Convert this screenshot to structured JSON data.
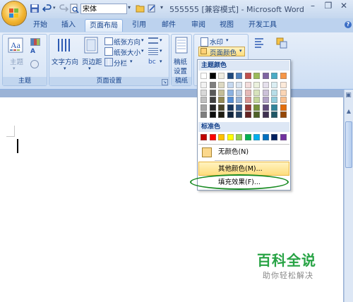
{
  "window": {
    "title": "555555 [兼容模式] - Microsoft Word"
  },
  "quick_access": {
    "font_name": "宋体"
  },
  "tabs": [
    {
      "label": "开始"
    },
    {
      "label": "插入"
    },
    {
      "label": "页面布局",
      "active": true
    },
    {
      "label": "引用"
    },
    {
      "label": "邮件"
    },
    {
      "label": "审阅"
    },
    {
      "label": "视图"
    },
    {
      "label": "开发工具"
    }
  ],
  "ribbon": {
    "theme_group": {
      "label": "主题",
      "theme_button": "主题"
    },
    "page_setup_group": {
      "label": "页面设置",
      "text_direction": "文字方向",
      "margins": "页边距",
      "orientation": "纸张方向",
      "size": "纸张大小",
      "columns": "分栏"
    },
    "manuscript_group": {
      "label": "稿纸",
      "setup_button_line1": "稿纸",
      "setup_button_line2": "设置"
    },
    "page_background_group": {
      "watermark": "水印",
      "page_color": "页面颜色"
    }
  },
  "page_color_menu": {
    "theme_colors_header": "主题颜色",
    "standard_colors_header": "标准色",
    "no_color": "无颜色(N)",
    "more_colors": "其他颜色(M)...",
    "fill_effects": "填充效果(F)...",
    "theme_columns": [
      [
        "#ffffff",
        "#f2f2f2",
        "#d8d8d8",
        "#bfbfbf",
        "#a5a5a5",
        "#7f7f7f"
      ],
      [
        "#000000",
        "#7f7f7f",
        "#595959",
        "#3f3f3f",
        "#262626",
        "#0c0c0c"
      ],
      [
        "#eeece1",
        "#ddd9c3",
        "#c4bd97",
        "#938953",
        "#494429",
        "#1d1b10"
      ],
      [
        "#1f497d",
        "#c6d9f0",
        "#8db3e2",
        "#548dd4",
        "#17365d",
        "#0f243e"
      ],
      [
        "#4f81bd",
        "#dbe5f1",
        "#b8cce4",
        "#95b3d7",
        "#366092",
        "#244061"
      ],
      [
        "#c0504d",
        "#f2dcdb",
        "#e5b9b7",
        "#d99694",
        "#953734",
        "#632423"
      ],
      [
        "#9bbb59",
        "#ebf1dd",
        "#d7e3bc",
        "#c3d69b",
        "#76923c",
        "#4f6128"
      ],
      [
        "#8064a2",
        "#e5e0ec",
        "#ccc1d9",
        "#b2a2c7",
        "#5f497a",
        "#3f3151"
      ],
      [
        "#4bacc6",
        "#dbeef3",
        "#b7dde8",
        "#92cddc",
        "#31859b",
        "#205867"
      ],
      [
        "#f79646",
        "#fdeada",
        "#fbd5b5",
        "#fac08f",
        "#e36c09",
        "#974806"
      ]
    ],
    "standard_colors": [
      "#c00000",
      "#ff0000",
      "#ffc000",
      "#ffff00",
      "#92d050",
      "#00b050",
      "#00b0f0",
      "#0070c0",
      "#002060",
      "#7030a0"
    ]
  },
  "watermark_overlay": {
    "title": "百科全说",
    "subtitle": "助你轻松解决"
  }
}
